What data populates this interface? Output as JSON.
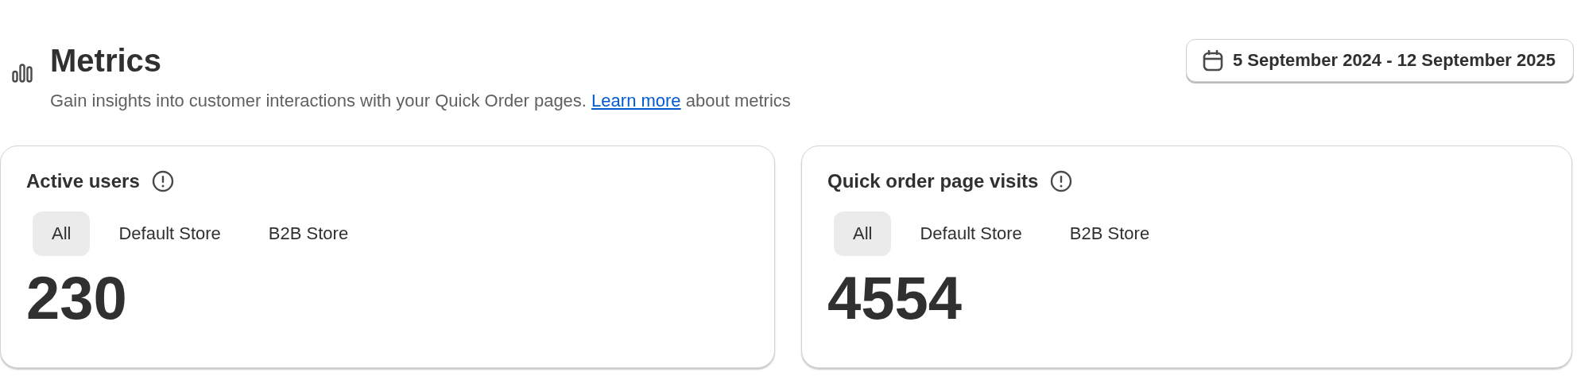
{
  "header": {
    "title": "Metrics",
    "description": "Gain insights into customer interactions with your Quick Order pages.",
    "link": "Learn more",
    "description_end": "about metrics",
    "date_range": "5 September 2024 - 12 September 2025"
  },
  "cards": [
    {
      "title": "Active users",
      "tabs": [
        {
          "label": "All",
          "selected": true
        },
        {
          "label": "Default Store",
          "selected": false
        },
        {
          "label": "B2B Store",
          "selected": false
        }
      ],
      "value": "230"
    },
    {
      "title": "Quick order page visits",
      "tabs": [
        {
          "label": "All",
          "selected": true
        },
        {
          "label": "Default Store",
          "selected": false
        },
        {
          "label": "B2B Store",
          "selected": false
        }
      ],
      "value": "4554"
    }
  ]
}
